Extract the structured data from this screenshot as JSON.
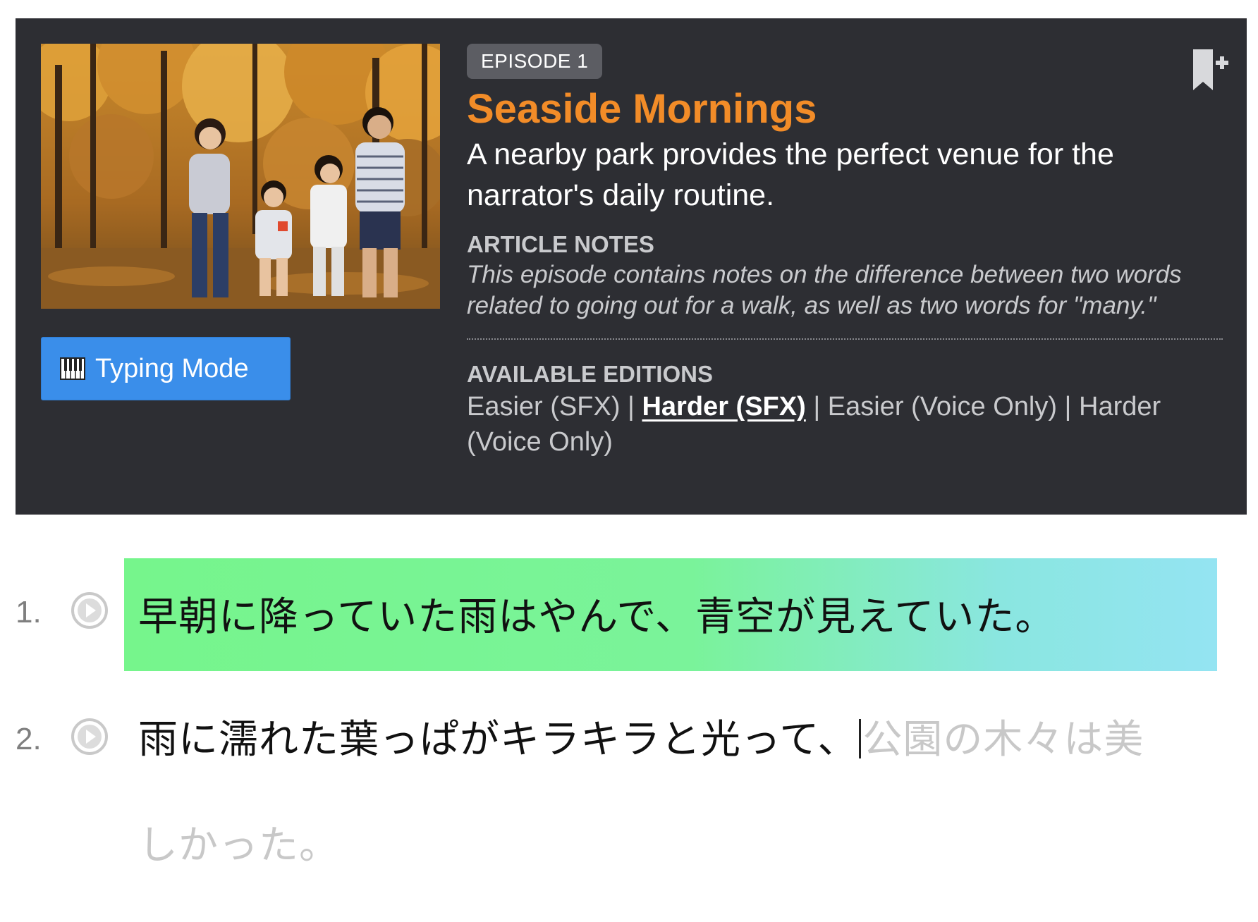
{
  "episode": {
    "badge": "EPISODE 1",
    "title": "Seaside Mornings",
    "description": "A nearby park provides the perfect venue for the narrator's daily routine.",
    "notes_label": "ARTICLE NOTES",
    "notes": "This episode contains notes on the difference between two words related to going out for a walk, as well as two words for \"many.\"",
    "editions_label": "AVAILABLE EDITIONS",
    "editions": [
      {
        "label": "Easier (SFX)",
        "current": false
      },
      {
        "label": "Harder (SFX)",
        "current": true
      },
      {
        "label": "Easier (Voice Only)",
        "current": false
      },
      {
        "label": "Harder (Voice Only)",
        "current": false
      }
    ],
    "edition_separator": " | "
  },
  "typing_button": {
    "label": "Typing Mode",
    "icon": "keyboard-icon"
  },
  "bookmark": {
    "icon": "bookmark-add-icon"
  },
  "sentences": [
    {
      "number": "1.",
      "text": "早朝に降っていた雨はやんで、青空が見えていた。"
    },
    {
      "number": "2.",
      "typed": "雨に濡れた葉っぱがキラキラと光って、",
      "pending_line1": "公園の木々は美",
      "pending_line2": "しかった。"
    }
  ],
  "colors": {
    "panel_bg": "#2d2e33",
    "title": "#f28c28",
    "button": "#3a8eea",
    "highlight_start": "#76f58c",
    "highlight_end": "#94e4f2",
    "pending_text": "#c8c8c8"
  }
}
